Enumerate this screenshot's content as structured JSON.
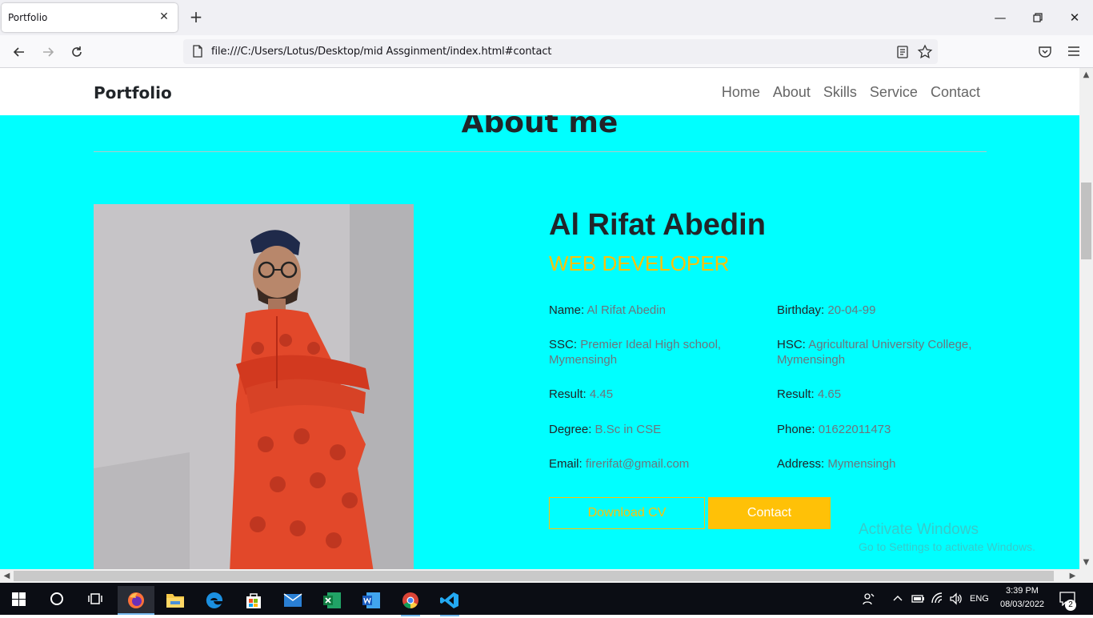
{
  "browser": {
    "tab_title": "Portfolio",
    "url": "file:///C:/Users/Lotus/Desktop/mid Assginment/index.html#contact"
  },
  "site": {
    "brand": "Portfolio",
    "nav": [
      "Home",
      "About",
      "Skills",
      "Service",
      "Contact"
    ]
  },
  "about": {
    "section_title": "About me",
    "name": "Al Rifat Abedin",
    "role": "WEB DEVELOPER",
    "info": [
      {
        "label": "Name:",
        "value": "Al Rifat Abedin"
      },
      {
        "label": "Birthday:",
        "value": "20-04-99"
      },
      {
        "label": "SSC:",
        "value": "Premier Ideal High school, Mymensingh"
      },
      {
        "label": "HSC:",
        "value": "Agricultural University College, Mymensingh"
      },
      {
        "label": "Result:",
        "value": "4.45"
      },
      {
        "label": "Result:",
        "value": "4.65"
      },
      {
        "label": "Degree:",
        "value": "B.Sc in CSE"
      },
      {
        "label": "Phone:",
        "value": "01622011473"
      },
      {
        "label": "Email:",
        "value": "firerifat@gmail.com"
      },
      {
        "label": "Address:",
        "value": "Mymensingh"
      }
    ],
    "buttons": {
      "download": "Download CV",
      "contact": "Contact"
    }
  },
  "watermark": {
    "line1": "Activate Windows",
    "line2": "Go to Settings to activate Windows."
  },
  "taskbar": {
    "language": "ENG",
    "time": "3:39 PM",
    "date": "08/03/2022",
    "notification_count": "2"
  },
  "colors": {
    "page_bg": "#00ffff",
    "accent": "#ffc107"
  }
}
